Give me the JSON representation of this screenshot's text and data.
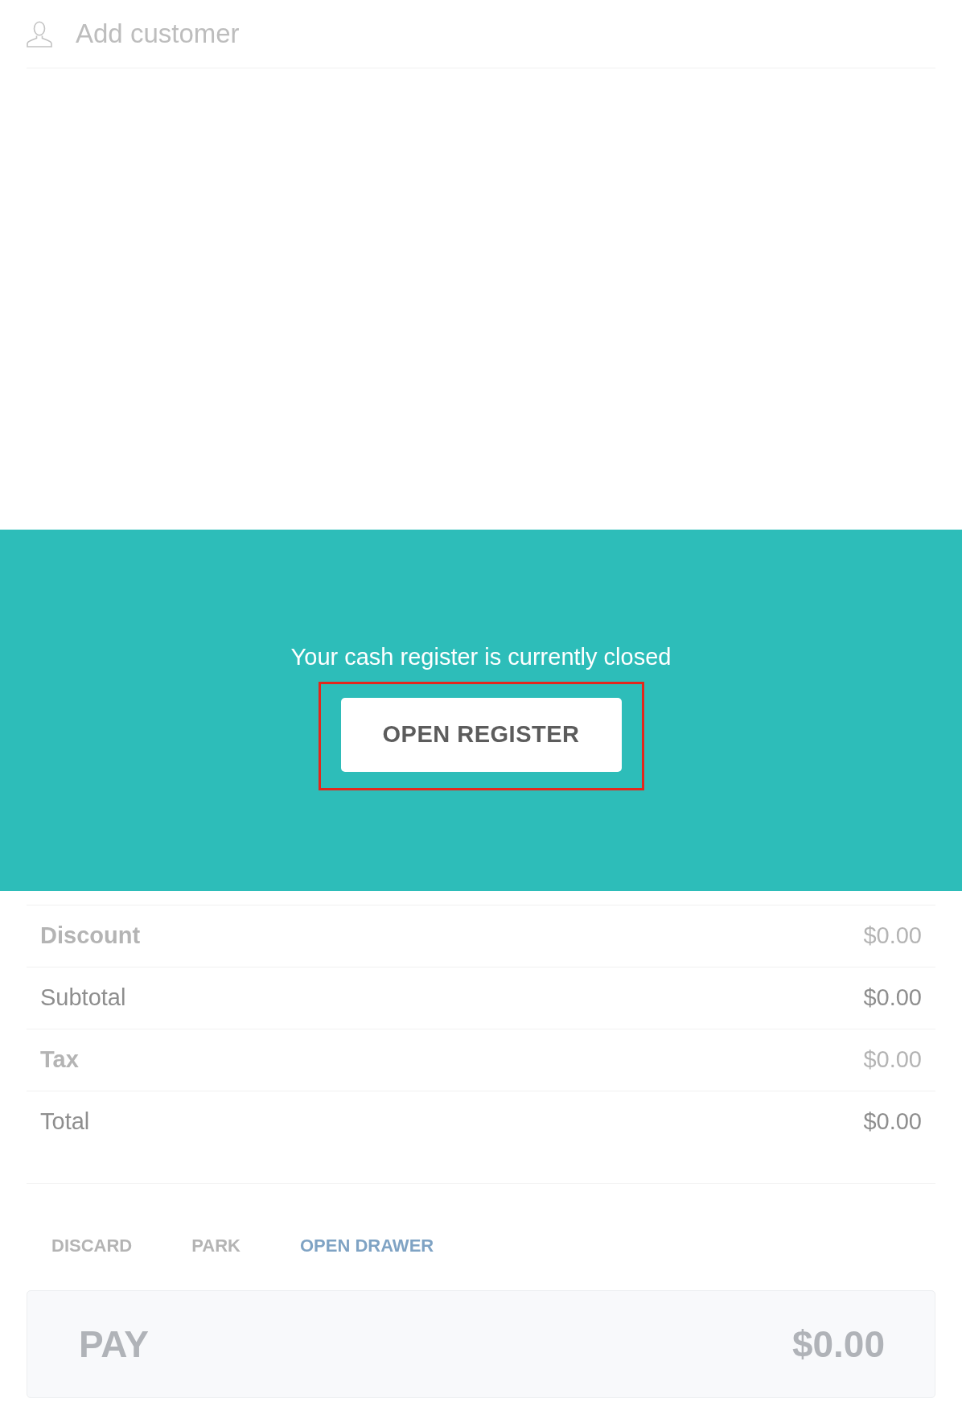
{
  "customer": {
    "label": "Add customer"
  },
  "register_notice": {
    "message": "Your cash register is currently closed",
    "button": {
      "label": "OPEN REGISTER",
      "highlighted": true
    }
  },
  "totals": [
    {
      "label": "Discount",
      "value": "$0.00",
      "disabled": true
    },
    {
      "label": "Subtotal",
      "value": "$0.00",
      "disabled": false
    },
    {
      "label": "Tax",
      "value": "$0.00",
      "disabled": true
    },
    {
      "label": "Total",
      "value": "$0.00",
      "disabled": false
    }
  ],
  "actions": [
    {
      "label": "DISCARD",
      "disabled": true
    },
    {
      "label": "PARK",
      "disabled": true
    },
    {
      "label": "OPEN DRAWER",
      "disabled": false
    }
  ],
  "pay_button": {
    "label": "PAY",
    "amount": "$0.00",
    "disabled": true
  }
}
